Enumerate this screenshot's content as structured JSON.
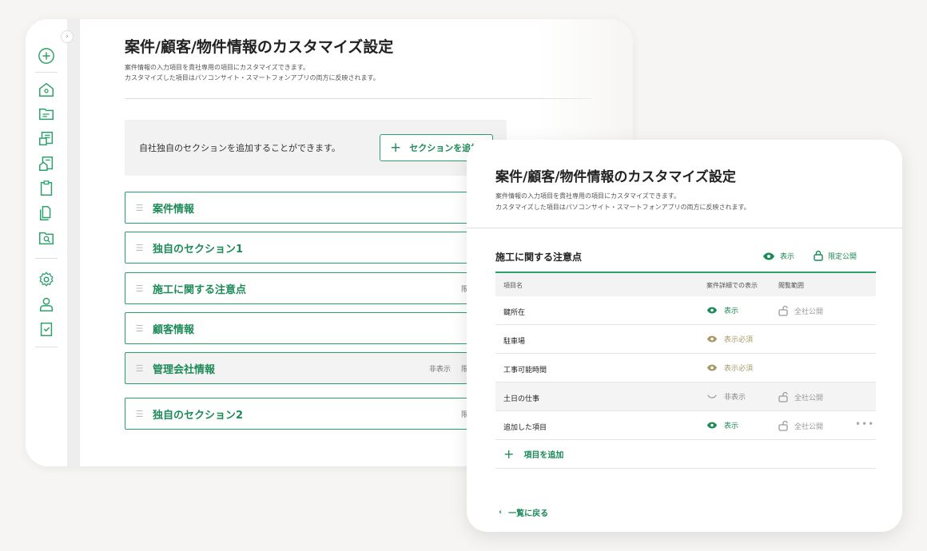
{
  "back": {
    "title": "案件/顧客/物件情報のカスタマイズ設定",
    "desc1": "案件情報の入力項目を貴社専用の項目にカスタマイズできます。",
    "desc2": "カスタマイズした項目はパソコンサイト・スマートフォンアプリの両方に反映されます。",
    "add_section_text": "自社独自のセクションを追加することができます。",
    "add_section_button": "セクションを追加",
    "sections": [
      {
        "label": "案件情報",
        "status": "",
        "status2": ""
      },
      {
        "label": "独自のセクション1",
        "status": "",
        "status2": ""
      },
      {
        "label": "施工に関する注意点",
        "status": "",
        "status2": "限"
      },
      {
        "label": "顧客情報",
        "status": "",
        "status2": ""
      },
      {
        "label": "管理会社情報",
        "status": "非表示",
        "status2": "限"
      },
      {
        "label": "独自のセクション2",
        "status": "",
        "status2": "限"
      }
    ],
    "sidebar_icons": [
      "add-circle-icon",
      "home-icon",
      "folder-list-icon",
      "customer-card-icon",
      "property-card-icon",
      "clipboard-icon",
      "files-icon",
      "search-folder-icon",
      "settings-icon",
      "user-icon",
      "checklist-icon"
    ]
  },
  "front": {
    "title": "案件/顧客/物件情報のカスタマイズ設定",
    "desc1": "案件情報の入力項目を貴社専用の項目にカスタマイズできます。",
    "desc2": "カスタマイズした項目はパソコンサイト・スマートフォンアプリの両方に反映されます。",
    "section_title": "施工に関する注意点",
    "visibility_label": "表示",
    "limited_label": "限定公開",
    "columns": {
      "name": "項目名",
      "display": "案件詳細での表示",
      "scope": "閲覧範囲"
    },
    "rows": [
      {
        "name": "鍵所在",
        "display": "表示",
        "scope": "全社公開"
      },
      {
        "name": "駐車場",
        "display": "表示必須",
        "scope": ""
      },
      {
        "name": "工事可能時間",
        "display": "表示必須",
        "scope": ""
      },
      {
        "name": "土日の仕事",
        "display": "非表示",
        "scope": "全社公開"
      },
      {
        "name": "追加した項目",
        "display": "表示",
        "scope": "全社公開"
      }
    ],
    "add_item": "項目を追加",
    "back_link": "一覧に戻る"
  },
  "colors": {
    "accent": "#1d8a58",
    "border_green": "#2aa06a",
    "muted_gold": "#a89b6a"
  }
}
